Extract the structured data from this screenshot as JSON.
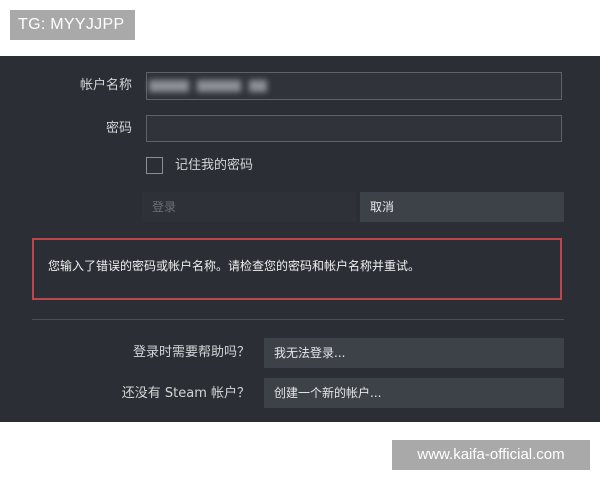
{
  "watermark_top": "TG: MYYJJPP",
  "login_form": {
    "account_label": "帐户名称",
    "account_value_blurred": "",
    "password_label": "密码",
    "password_value": "",
    "remember_label": "记住我的密码",
    "remember_checked": false,
    "login_button": "登录",
    "cancel_button": "取消"
  },
  "error_message": "您输入了错误的密码或帐户名称。请检查您的密码和帐户名称并重试。",
  "help": {
    "need_help_label": "登录时需要帮助吗？",
    "cant_login_button": "我无法登录...",
    "no_account_label": "还没有 Steam 帐户？",
    "create_account_button": "创建一个新的帐户..."
  },
  "watermark_bottom": "www.kaifa-official.com",
  "colors": {
    "panel_bg": "#2b2e34",
    "error_border": "#b9474b",
    "button_bg": "#3d4148"
  }
}
